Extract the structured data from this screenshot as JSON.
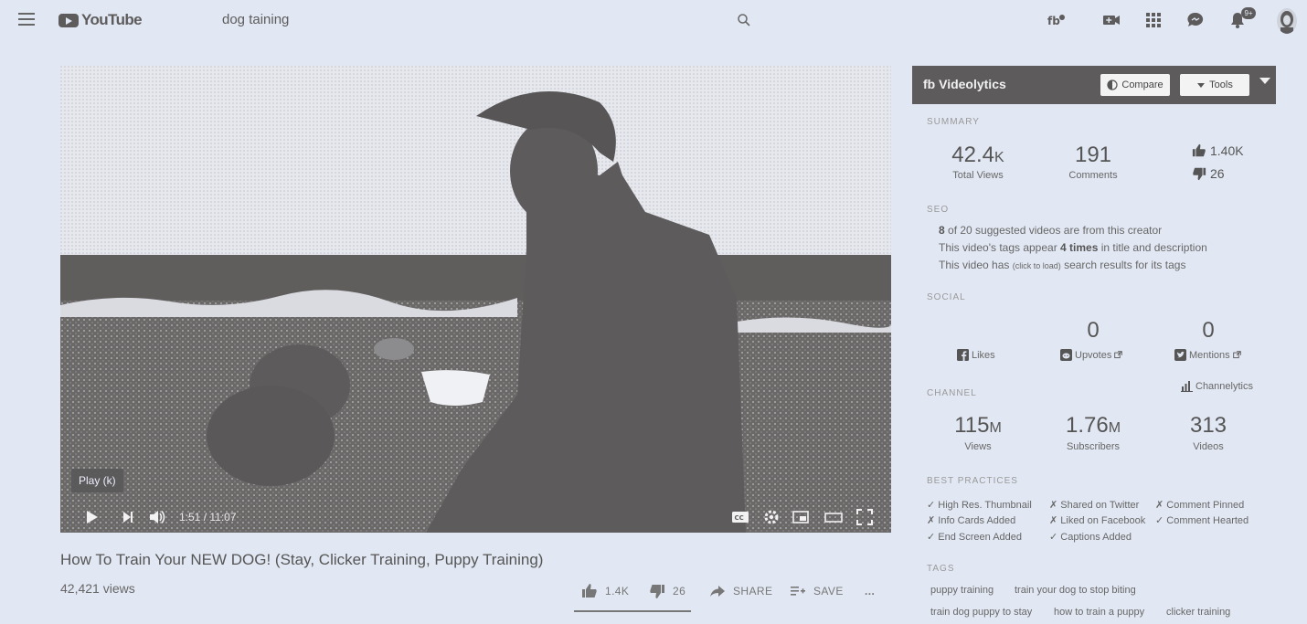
{
  "masthead": {
    "logo_text": "YouTube",
    "search_query": "dog taining",
    "notification_count": "9+"
  },
  "player": {
    "tooltip": "Play (k)",
    "time_current": "1:51",
    "time_separator": " / ",
    "time_total": "11:07",
    "progress_fraction": 0.166
  },
  "video": {
    "title": "How To Train Your NEW DOG! (Stay, Clicker Training, Puppy Training)",
    "views": "42,421 views",
    "actions": {
      "likes": "1.4K",
      "dislikes": "26",
      "share": "SHARE",
      "save": "SAVE",
      "more": "..."
    }
  },
  "videolytics": {
    "brand_mark": "fb",
    "title": "Videolytics",
    "compare_label": "Compare",
    "tools_label": "Tools",
    "summary": {
      "label": "SUMMARY",
      "total_views": {
        "num": "42.4",
        "unit": "K",
        "label": "Total Views"
      },
      "comments": {
        "num": "191",
        "label": "Comments"
      },
      "likes": "1.40K",
      "dislikes": "26"
    },
    "seo": {
      "label": "SEO",
      "line1_bold": "8",
      "line1_rest": " of 20 suggested videos are from this creator",
      "line2_a": "This video's tags appear ",
      "line2_bold": "4 times",
      "line2_b": " in title and description",
      "line3_a": "This video has ",
      "line3_small": "(click to load)",
      "line3_b": " search results for its tags"
    },
    "social": {
      "label": "SOCIAL",
      "likes_label": "Likes",
      "upvotes_value": "0",
      "upvotes_label": "Upvotes",
      "mentions_value": "0",
      "mentions_label": "Mentions"
    },
    "channel": {
      "label": "CHANNEL",
      "link": "Channelytics",
      "views": {
        "num": "115",
        "unit": "M",
        "label": "Views"
      },
      "subscribers": {
        "num": "1.76",
        "unit": "M",
        "label": "Subscribers"
      },
      "videos": {
        "num": "313",
        "label": "Videos"
      }
    },
    "best_practices": {
      "label": "BEST PRACTICES",
      "items": [
        "✓ High Res. Thumbnail",
        "✗ Shared on Twitter",
        "✗ Comment Pinned",
        "✗ Info Cards Added",
        "✗ Liked on Facebook",
        "✓ Comment Hearted",
        "✓ End Screen Added",
        "✓ Captions Added"
      ]
    },
    "tags": {
      "label": "TAGS",
      "items": [
        "puppy training",
        "train your dog to stop biting",
        "train dog puppy to stay",
        "how to train a puppy",
        "clicker training"
      ]
    }
  }
}
